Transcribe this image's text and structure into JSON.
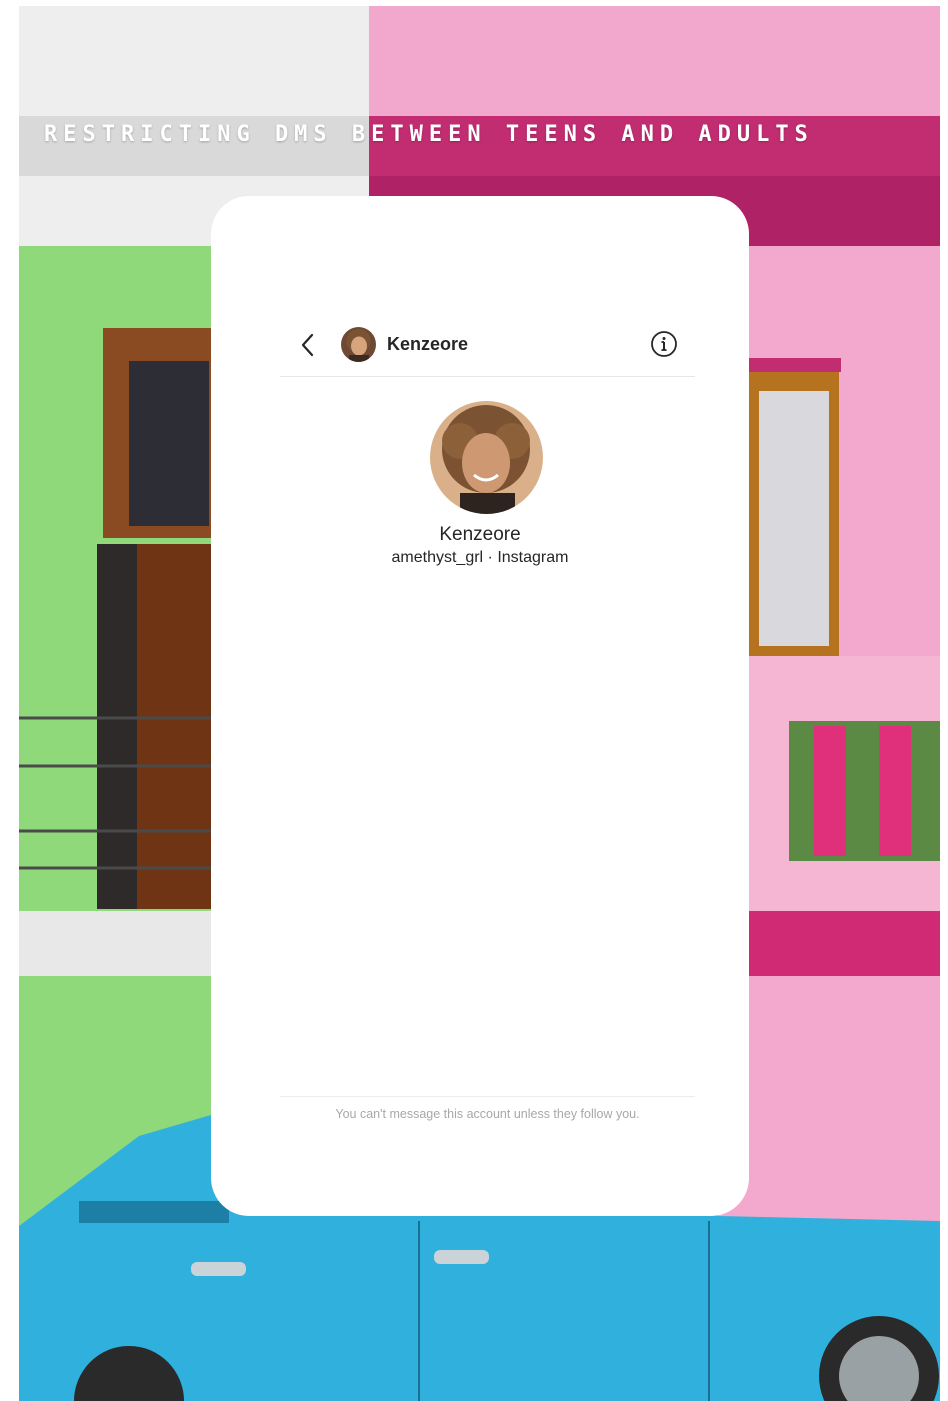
{
  "page": {
    "headline": "RESTRICTING DMS BETWEEN TEENS AND ADULTS"
  },
  "background": {
    "description_icon": "house-facade-photo",
    "colors": {
      "pink": "#f2a8cc",
      "green": "#8fd97a",
      "car": "#2fb0dd"
    }
  },
  "chat": {
    "back_icon": "chevron-left-icon",
    "info_icon": "info-icon",
    "header_name": "Kenzeore",
    "profile_name": "Kenzeore",
    "profile_subtitle": "amethyst_grl · Instagram",
    "restriction_notice": "You can't message this account unless they follow you."
  }
}
